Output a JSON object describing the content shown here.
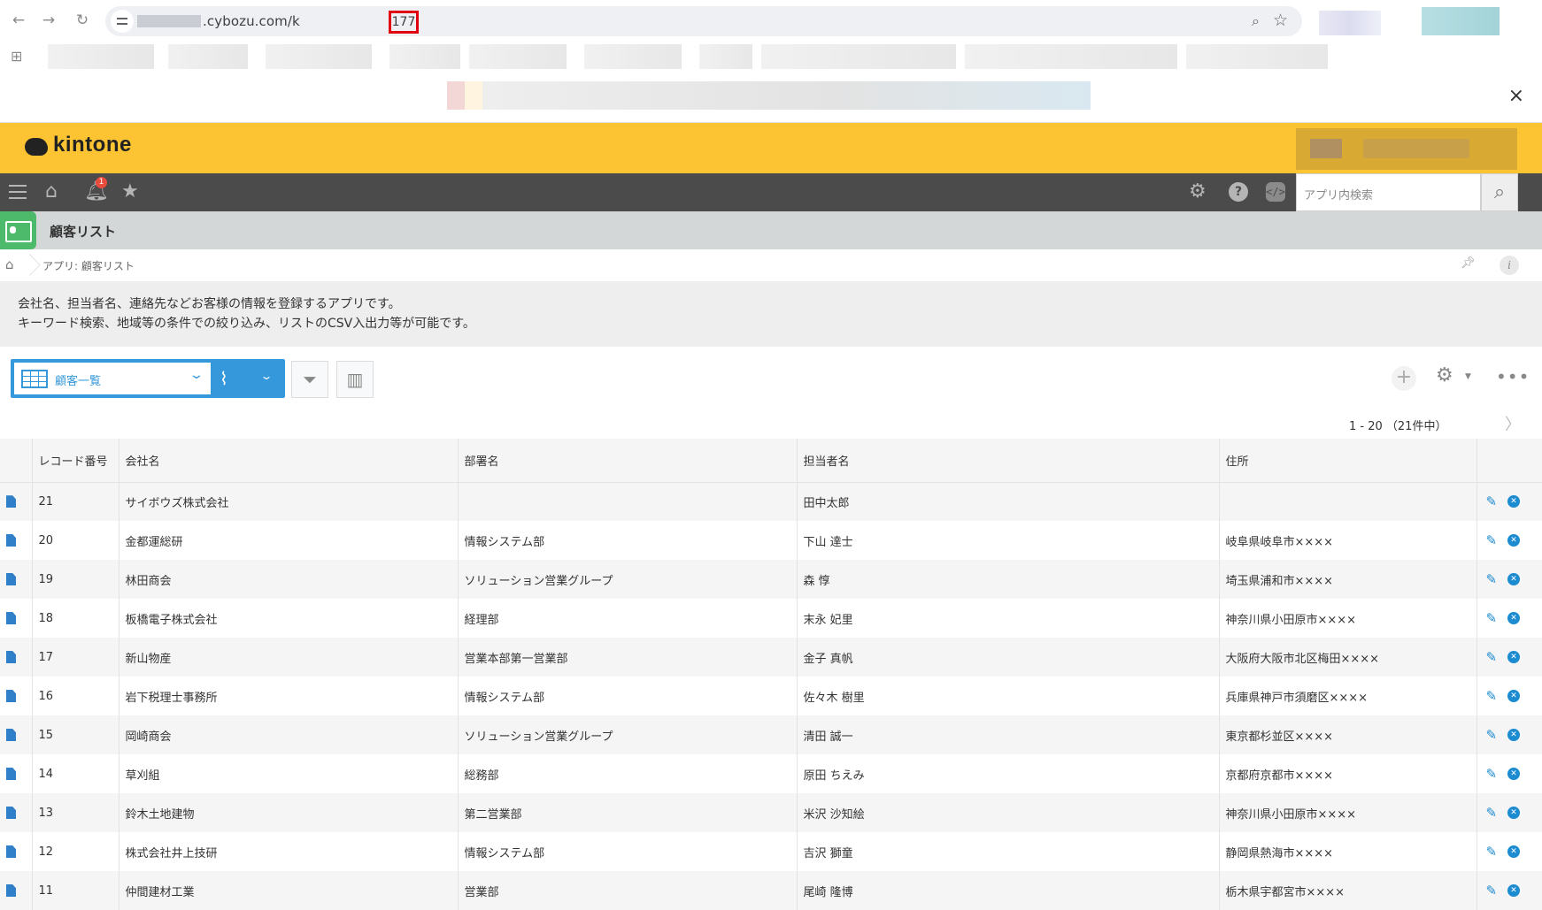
{
  "browser": {
    "url_domain": ".cybozu.com/k",
    "url_highlight": "177"
  },
  "header": {
    "logo_text": "kintone",
    "notification_count": "1",
    "search_placeholder": "アプリ内検索"
  },
  "app": {
    "title": "顧客リスト",
    "breadcrumb": "アプリ: 顧客リスト",
    "description_line1": "会社名、担当者名、連絡先などお客様の情報を登録するアプリです。",
    "description_line2": "キーワード検索、地域等の条件での絞り込み、リストのCSV入出力等が可能です。"
  },
  "view": {
    "name": "顧客一覧",
    "pager": "1 - 20 （21件中）"
  },
  "table": {
    "headers": [
      "レコード番号",
      "会社名",
      "部署名",
      "担当者名",
      "住所"
    ],
    "rows": [
      {
        "id": "21",
        "company": "サイボウズ株式会社",
        "dept": "",
        "person": "田中太郎",
        "address": ""
      },
      {
        "id": "20",
        "company": "金都運総研",
        "dept": "情報システム部",
        "person": "下山 達士",
        "address": "岐阜県岐阜市××××"
      },
      {
        "id": "19",
        "company": "林田商会",
        "dept": "ソリューション営業グループ",
        "person": "森 惇",
        "address": "埼玉県浦和市××××"
      },
      {
        "id": "18",
        "company": "板橋電子株式会社",
        "dept": "経理部",
        "person": "末永 妃里",
        "address": "神奈川県小田原市××××"
      },
      {
        "id": "17",
        "company": "新山物産",
        "dept": "営業本部第一営業部",
        "person": "金子 真帆",
        "address": "大阪府大阪市北区梅田××××"
      },
      {
        "id": "16",
        "company": "岩下税理士事務所",
        "dept": "情報システム部",
        "person": "佐々木 樹里",
        "address": "兵庫県神戸市須磨区××××"
      },
      {
        "id": "15",
        "company": "岡崎商会",
        "dept": "ソリューション営業グループ",
        "person": "清田 誠一",
        "address": "東京都杉並区××××"
      },
      {
        "id": "14",
        "company": "草刈組",
        "dept": "総務部",
        "person": "原田 ちえみ",
        "address": "京都府京都市××××"
      },
      {
        "id": "13",
        "company": "鈴木土地建物",
        "dept": "第二営業部",
        "person": "米沢 沙知絵",
        "address": "神奈川県小田原市××××"
      },
      {
        "id": "12",
        "company": "株式会社井上技研",
        "dept": "情報システム部",
        "person": "吉沢 獅童",
        "address": "静岡県熱海市××××"
      },
      {
        "id": "11",
        "company": "仲間建材工業",
        "dept": "営業部",
        "person": "尾崎 隆博",
        "address": "栃木県宇都宮市××××"
      }
    ]
  }
}
